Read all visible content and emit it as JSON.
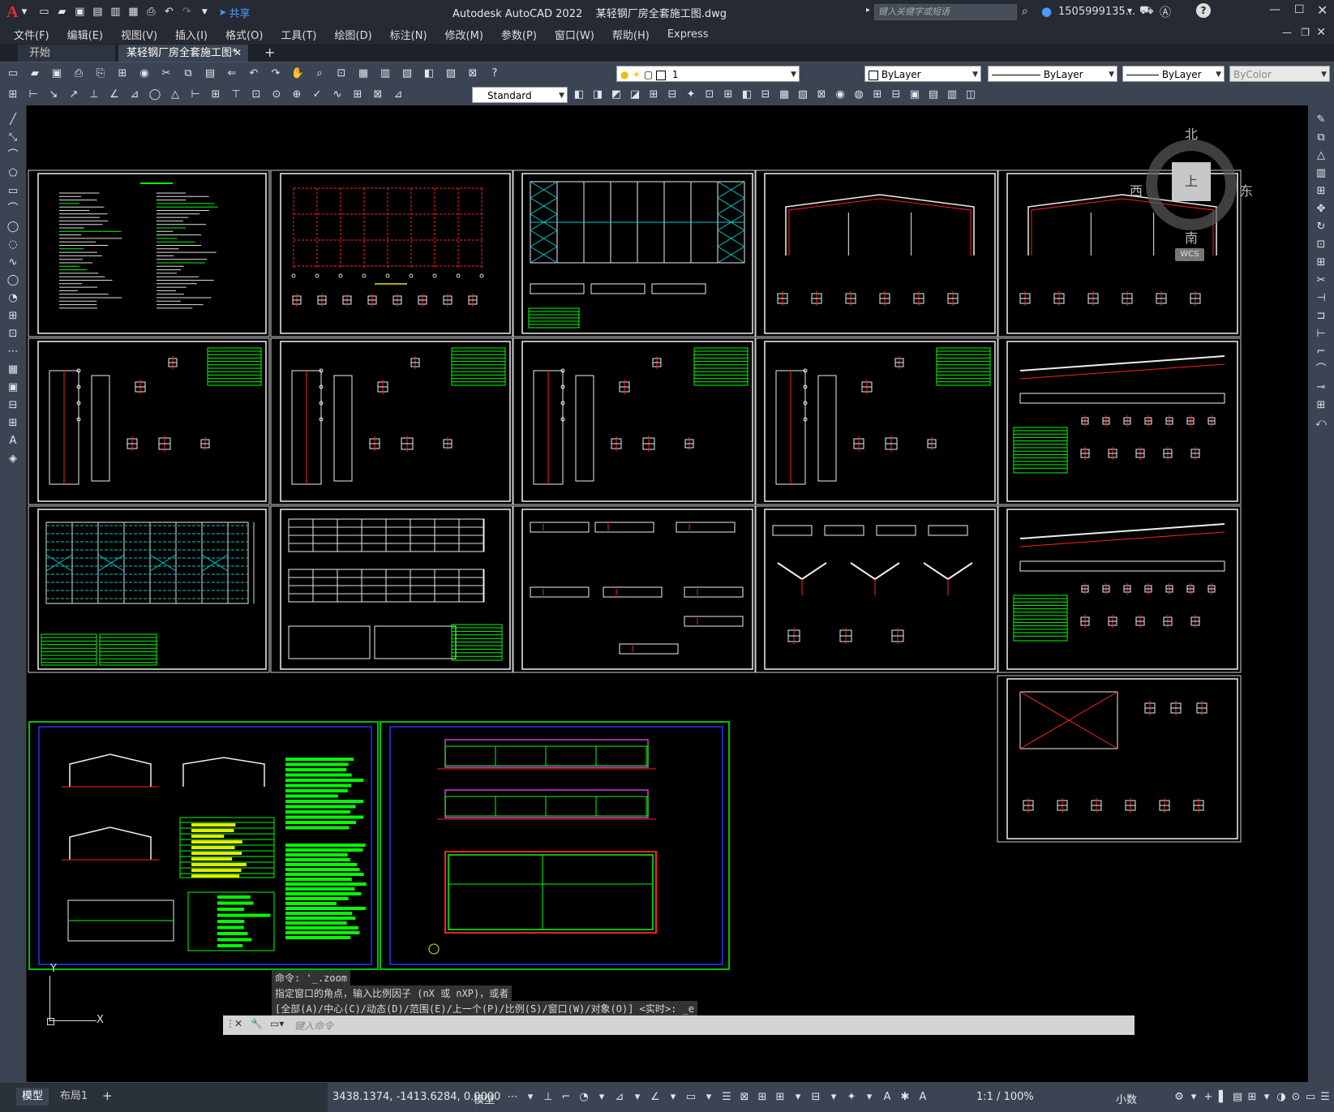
{
  "title_bar": {
    "app_logo": "A",
    "share_label": "共享",
    "title": "Autodesk AutoCAD 2022    某轻钢厂房全套施工图.dwg",
    "search_placeholder": "键入关键字或短语",
    "user": "1505999135...",
    "icons": [
      "new-icon",
      "open-icon",
      "save-icon",
      "save-as-icon",
      "open-web-icon",
      "save-web-icon",
      "plot-icon",
      "undo-icon",
      "redo-icon",
      "share-icon"
    ]
  },
  "menu": [
    "文件(F)",
    "编辑(E)",
    "视图(V)",
    "插入(I)",
    "格式(O)",
    "工具(T)",
    "绘图(D)",
    "标注(N)",
    "修改(M)",
    "参数(P)",
    "窗口(W)",
    "帮助(H)",
    "Express"
  ],
  "tabs": [
    {
      "label": "开始",
      "active": false
    },
    {
      "label": "某轻钢厂房全套施工图*",
      "active": true
    }
  ],
  "toolbar": {
    "layer_value": "1",
    "color_value": "ByLayer",
    "linetype_value": "ByLayer",
    "lineweight_value": "ByLayer",
    "plotstyle_value": "ByColor",
    "textstyle_value": "Standard"
  },
  "viewcube": {
    "north": "北",
    "south": "南",
    "east": "东",
    "west": "西",
    "top": "上",
    "wcs": "WCS"
  },
  "ucs": {
    "y": "Y",
    "x": "X"
  },
  "command": {
    "history": [
      "命令: '_.zoom",
      "指定窗口的角点，输入比例因子 (nX 或 nXP)，或者",
      "[全部(A)/中心(C)/动态(D)/范围(E)/上一个(P)/比例(S)/窗口(W)/对象(O)] <实时>: _e"
    ],
    "placeholder": "键入命令"
  },
  "layout_tabs": [
    {
      "label": "模型",
      "active": true
    },
    {
      "label": "布局1",
      "active": false
    }
  ],
  "status": {
    "coords": "3438.1374, -1413.6284, 0.0000",
    "model": "模型",
    "scale": "1:1 / 100%",
    "units": "小数"
  },
  "colors": {
    "bg": "#000000",
    "panel": "#3b4453",
    "title": "#252a33",
    "accent": "#4a90e2",
    "red": "#ff2020",
    "green": "#00ff00",
    "cyan": "#00c8c8"
  }
}
